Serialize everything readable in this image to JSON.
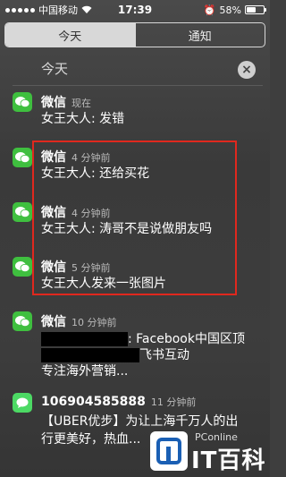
{
  "status_bar": {
    "carrier": "中国移动",
    "time": "17:39",
    "battery": "58%",
    "battery_level": 0.58
  },
  "tabs": [
    {
      "label": "今天",
      "active": true
    },
    {
      "label": "通知",
      "active": false
    }
  ],
  "section": {
    "title": "今天",
    "clear_icon": "close-icon",
    "clear_label": "×"
  },
  "notifications": [
    {
      "app": "微信",
      "time": "现在",
      "lines": [
        "女王大人: 发错"
      ]
    },
    {
      "app": "微信",
      "time": "4 分钟前",
      "lines": [
        "女王大人: 还给买花"
      ]
    },
    {
      "app": "微信",
      "time": "4 分钟前",
      "lines": [
        "女王大人: 涛哥不是说做朋友吗"
      ]
    },
    {
      "app": "微信",
      "time": "5 分钟前",
      "lines": [
        "女王大人发来一张图片"
      ]
    },
    {
      "app": "微信",
      "time": "10 分钟前",
      "lines": [
        ": Facebook中国区顶",
        "飞书互动",
        "专注海外营销..."
      ]
    },
    {
      "app": "106904585888",
      "time": "11 分钟前",
      "lines": [
        "【UBER优步】为让上海千万人的出",
        "行更美好，热血..."
      ]
    }
  ],
  "watermark": {
    "brand": "PConline",
    "name": "IT百科"
  },
  "colors": {
    "wechat_green": "#3fbf3f",
    "message_green": "#4cd964",
    "highlight_red": "#e0281e"
  }
}
